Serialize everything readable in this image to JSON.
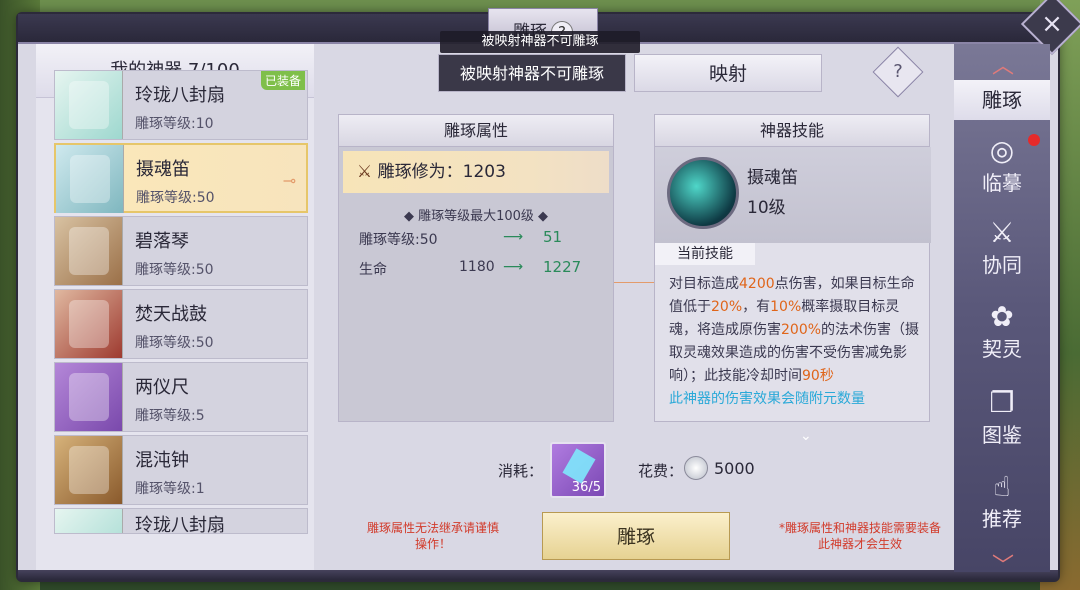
{
  "title": "雕琢",
  "title_help_icon": "?",
  "tooltip": "被映射神器不可雕琢",
  "close_icon": "×",
  "left_header": "我的神器 7/100",
  "items": [
    {
      "name": "玲珑八封扇",
      "level": "雕琢等级:10",
      "badge": "已装备",
      "thumb": "fan"
    },
    {
      "name": "摄魂笛",
      "level": "雕琢等级:50",
      "thumb": "flute"
    },
    {
      "name": "碧落琴",
      "level": "雕琢等级:50",
      "thumb": "qin"
    },
    {
      "name": "焚天战鼓",
      "level": "雕琢等级:50",
      "thumb": "drum"
    },
    {
      "name": "两仪尺",
      "level": "雕琢等级:5",
      "thumb": "ruler"
    },
    {
      "name": "混沌钟",
      "level": "雕琢等级:1",
      "thumb": "bell"
    },
    {
      "name": "玲珑八封扇",
      "level": "",
      "thumb": "fan"
    }
  ],
  "tabs": {
    "disabled": "被映射神器不可雕琢",
    "map": "映射"
  },
  "help": "?",
  "attr": {
    "title": "雕琢属性",
    "xiuwei": "雕琢修为：1203",
    "maxlevel": "◆ 雕琢等级最大100级 ◆",
    "level_label": "雕琢等级:50",
    "level_arrow": "⟶",
    "level_to": "51",
    "life_label": "生命",
    "life_from": "1180",
    "life_arrow": "⟶",
    "life_to": "1227"
  },
  "skill": {
    "title": "神器技能",
    "name": "摄魂笛",
    "level": "10级",
    "current": "当前技能",
    "d1": "对目标造成",
    "d2": "4200",
    "d3": "点伤害，如果目标生命值低于",
    "d4": "20%",
    "d5": "，有",
    "d6": "10%",
    "d7": "概率摄取目标灵魂，将造成原伤害",
    "d8": "200%",
    "d9": "的法术伤害（摄取灵魂效果造成的伤害不受伤害减免影响）；此技能冷却时间",
    "d10": "90秒",
    "note": "此神器的伤害效果会随附元数量"
  },
  "cost": {
    "label": "消耗：",
    "qty": "36/5"
  },
  "fee": {
    "label": "花费：",
    "value": "5000"
  },
  "warn_left": "雕琢属性无法继承请谨慎操作！",
  "warn_right": "*雕琢属性和神器技能需要装备此神器才会生效",
  "main_button": "雕琢",
  "nav": [
    {
      "label": "雕琢",
      "icon": ""
    },
    {
      "label": "临摹",
      "icon": "◎"
    },
    {
      "label": "协同",
      "icon": "⚔"
    },
    {
      "label": "契灵",
      "icon": "✿"
    },
    {
      "label": "图鉴",
      "icon": "❐"
    },
    {
      "label": "推荐",
      "icon": "☝"
    }
  ],
  "colors": {
    "accent_orange": "#e0651a",
    "note_blue": "#2aa9d8",
    "warn_red": "#d23b2b",
    "up_green": "#2a8a5a"
  }
}
